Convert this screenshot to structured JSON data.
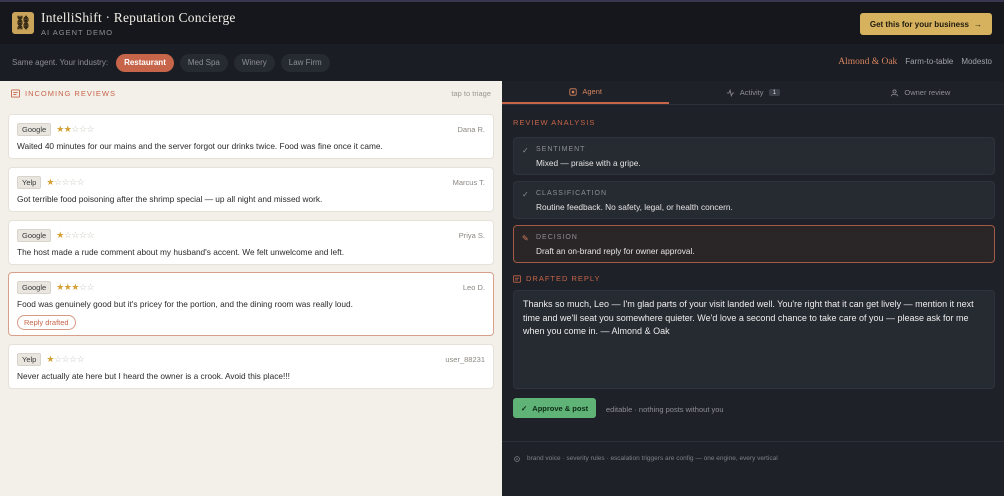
{
  "header": {
    "logo_glyph": "⛓",
    "title": "IntelliShift · Reputation Concierge",
    "subtitle": "AI AGENT DEMO",
    "cta_label": "Get this for your business",
    "cta_arrow": "→"
  },
  "industry_bar": {
    "label": "Same agent. Your industry:",
    "chips": [
      "Restaurant",
      "Med Spa",
      "Winery",
      "Law Firm"
    ],
    "active_chip": "Restaurant",
    "business_name": "Almond & Oak",
    "business_type": "Farm-to-table",
    "business_city": "Modesto"
  },
  "incoming": {
    "icon": "inbox-icon",
    "label": "INCOMING REVIEWS",
    "hint": "tap to triage",
    "reviews": [
      {
        "source": "Google",
        "rating": 2,
        "author": "Dana R.",
        "text": "Waited 40 minutes for our mains and the server forgot our drinks twice. Food was fine once it came.",
        "tag": ""
      },
      {
        "source": "Yelp",
        "rating": 1,
        "author": "Marcus T.",
        "text": "Got terrible food poisoning after the shrimp special — up all night and missed work.",
        "tag": ""
      },
      {
        "source": "Google",
        "rating": 1,
        "author": "Priya S.",
        "text": "The host made a rude comment about my husband's accent. We felt unwelcome and left.",
        "tag": ""
      },
      {
        "source": "Google",
        "rating": 3,
        "author": "Leo D.",
        "text": "Food was genuinely good but it's pricey for the portion, and the dining room was really loud.",
        "tag": "Reply drafted"
      },
      {
        "source": "Yelp",
        "rating": 1,
        "author": "user_88231",
        "text": "Never actually ate here but I heard the owner is a crook. Avoid this place!!!",
        "tag": ""
      }
    ]
  },
  "right": {
    "tabs": {
      "agent": "Agent",
      "activity": "Activity",
      "activity_count": "1",
      "owner": "Owner review"
    },
    "analysis_label": "REVIEW ANALYSIS",
    "sentiment_title": "SENTIMENT",
    "sentiment_value": "Mixed — praise with a gripe.",
    "classification_title": "CLASSIFICATION",
    "classification_value": "Routine feedback. No safety, legal, or health concern.",
    "decision_title": "DECISION",
    "decision_value": "Draft an on-brand reply for owner approval.",
    "drafted_label": "DRAFTED REPLY",
    "draft_text": "Thanks so much, Leo — I'm glad parts of your visit landed well. You're right that it can get lively — mention it next time and we'll seat you somewhere quieter. We'd love a second chance to take care of you — please ask for me when you come in. — Almond & Oak",
    "approve_label": "Approve & post",
    "approve_note": "editable · nothing posts without you",
    "footer_note": "brand voice · severity rules · escalation triggers are config — one engine, every vertical"
  },
  "colors": {
    "accent": "#c7654a",
    "gold": "#d6b25e",
    "approve": "#5fb376",
    "star": "#d3a033"
  }
}
